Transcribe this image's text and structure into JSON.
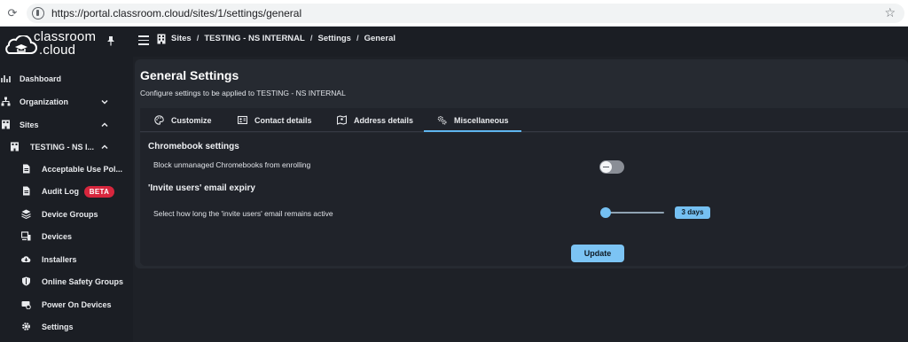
{
  "browser": {
    "url": "https://portal.classroom.cloud/sites/1/settings/general"
  },
  "app": {
    "logo_line1": "classroom",
    "logo_line2": ".cloud"
  },
  "breadcrumb": [
    "Sites",
    "TESTING - NS INTERNAL",
    "Settings",
    "General"
  ],
  "breadcrumb_separator": "/",
  "sidebar": {
    "items": [
      {
        "label": "Dashboard",
        "icon": "chart-icon"
      },
      {
        "label": "Organization",
        "icon": "org-icon",
        "expanded": false
      },
      {
        "label": "Sites",
        "icon": "building-icon",
        "expanded": true
      },
      {
        "label": "TESTING - NS I...",
        "icon": "building-icon",
        "expanded": true
      },
      {
        "label": "Acceptable Use Pol...",
        "icon": "document-icon"
      },
      {
        "label": "Audit Log",
        "icon": "document-icon",
        "badge": "BETA"
      },
      {
        "label": "Device Groups",
        "icon": "layers-icon"
      },
      {
        "label": "Devices",
        "icon": "devices-icon"
      },
      {
        "label": "Installers",
        "icon": "cloud-download-icon"
      },
      {
        "label": "Online Safety Groups",
        "icon": "shield-icon"
      },
      {
        "label": "Power On Devices",
        "icon": "power-device-icon"
      },
      {
        "label": "Settings",
        "icon": "gear-icon"
      }
    ]
  },
  "page": {
    "title": "General Settings",
    "subtitle": "Configure settings to be applied to TESTING - NS INTERNAL"
  },
  "tabs": [
    {
      "label": "Customize",
      "icon": "palette-icon"
    },
    {
      "label": "Contact details",
      "icon": "contact-card-icon"
    },
    {
      "label": "Address details",
      "icon": "map-icon"
    },
    {
      "label": "Miscellaneous",
      "icon": "gears-icon",
      "active": true
    }
  ],
  "chromebook": {
    "section_title": "Chromebook settings",
    "block_label": "Block unmanaged Chromebooks from enrolling",
    "block_enabled": false
  },
  "invite": {
    "section_title": "'Invite users' email expiry",
    "expiry_label": "Select how long the 'invite users' email remains active",
    "expiry_value": "3 days"
  },
  "actions": {
    "update_label": "Update"
  },
  "colors": {
    "accent": "#75c0f2",
    "beta_badge": "#d7263d",
    "background": "#1e2127"
  }
}
